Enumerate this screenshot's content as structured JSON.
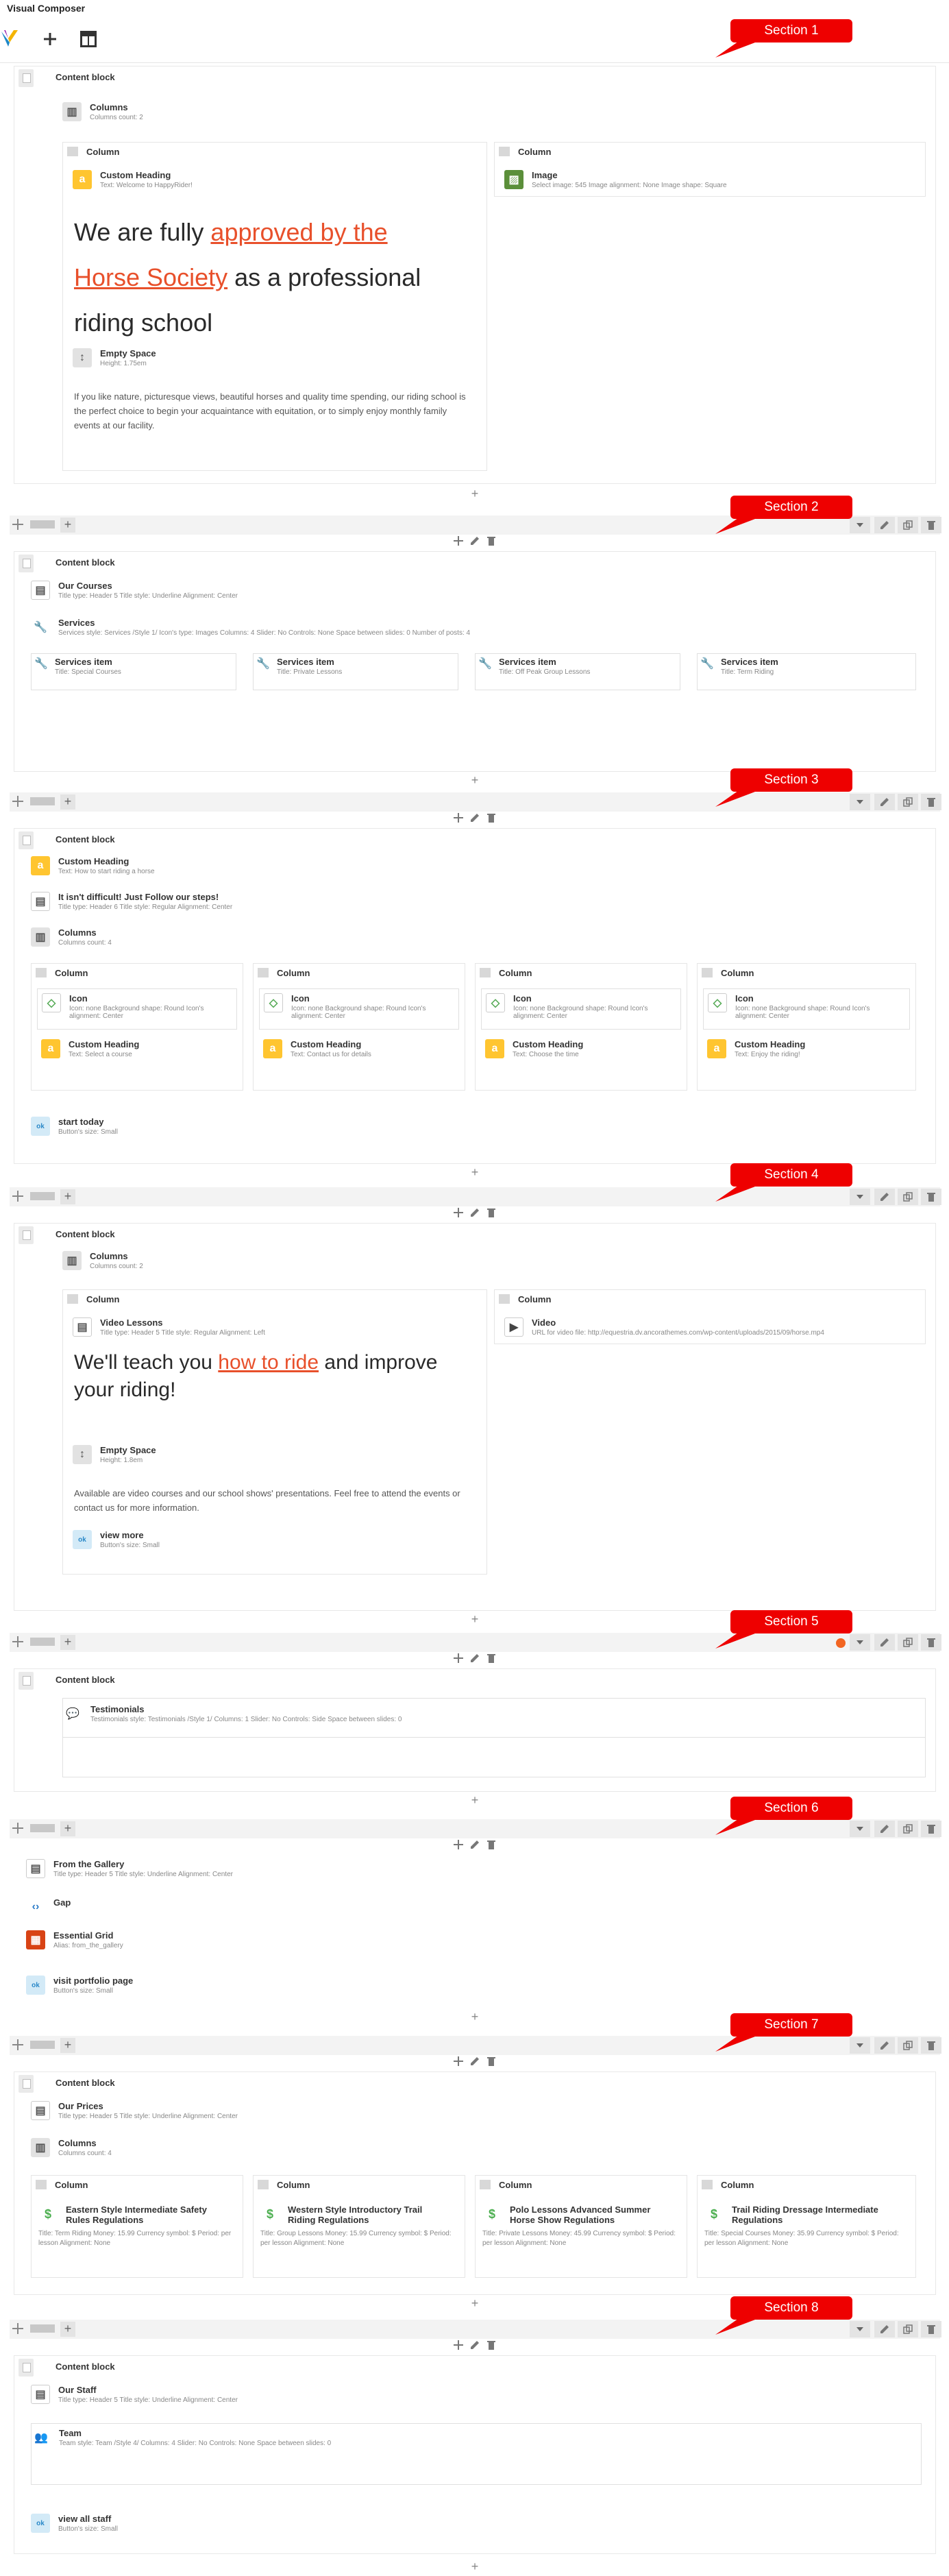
{
  "app_title": "Visual Composer",
  "toolbar": {
    "add_label": "+",
    "templates_icon": "layout-icon"
  },
  "sections": [
    {
      "label": "Section 1"
    },
    {
      "label": "Section 2"
    },
    {
      "label": "Section 3"
    },
    {
      "label": "Section 4"
    },
    {
      "label": "Section 5"
    },
    {
      "label": "Section 6"
    },
    {
      "label": "Section 7"
    },
    {
      "label": "Section 8"
    }
  ],
  "common": {
    "content_block": "Content block",
    "column": "Column",
    "add": "+"
  },
  "s1": {
    "columns_title": "Columns",
    "columns_params": "Columns count: 2",
    "heading_title": "Custom Heading",
    "heading_params": "Text: Welcome to HappyRider!",
    "big_pre": "We are fully",
    "big_link": "approved by the Horse Society",
    "big_post": "as a professional riding school",
    "space_title": "Empty Space",
    "space_params": "Height: 1.75em",
    "paragraph": "If you like nature, picturesque views, beautiful horses and quality time spending, our riding school is the perfect choice to begin your acquaintance with equitation, or to simply enjoy monthly family events at our facility.",
    "image_title": "Image",
    "image_params": "Select image: 545 Image alignment: None Image shape: Square"
  },
  "s2": {
    "heading_title": "Our Courses",
    "heading_params": "Title type: Header 5 Title style: Underline Alignment: Center",
    "services_title": "Services",
    "services_params": "Services style: Services /Style 1/ Icon's type: Images Columns: 4 Slider: No Controls: None Space between slides: 0 Number of posts: 4",
    "items": [
      {
        "title": "Services item",
        "params": "Title: Special Courses"
      },
      {
        "title": "Services item",
        "params": "Title: Private Lessons"
      },
      {
        "title": "Services item",
        "params": "Title: Off Peak Group Lessons"
      },
      {
        "title": "Services item",
        "params": "Title: Term Riding"
      }
    ]
  },
  "s3": {
    "h1_title": "Custom Heading",
    "h1_params": "Text: How to start riding a horse",
    "h2_title": "It isn't difficult! Just Follow our steps!",
    "h2_params": "Title type: Header 6 Title style: Regular Alignment: Center",
    "columns_title": "Columns",
    "columns_params": "Columns count: 4",
    "cols": [
      {
        "icon_title": "Icon",
        "icon_params": "Icon: none Background shape: Round Icon's alignment: Center",
        "heading_title": "Custom Heading",
        "heading_params": "Text: Select a course"
      },
      {
        "icon_title": "Icon",
        "icon_params": "Icon: none Background shape: Round Icon's alignment: Center",
        "heading_title": "Custom Heading",
        "heading_params": "Text: Contact us for details"
      },
      {
        "icon_title": "Icon",
        "icon_params": "Icon: none Background shape: Round Icon's alignment: Center",
        "heading_title": "Custom Heading",
        "heading_params": "Text: Choose the time"
      },
      {
        "icon_title": "Icon",
        "icon_params": "Icon: none Background shape: Round Icon's alignment: Center",
        "heading_title": "Custom Heading",
        "heading_params": "Text: Enjoy the riding!"
      }
    ],
    "button_title": "start today",
    "button_params": "Button's size: Small"
  },
  "s4": {
    "columns_title": "Columns",
    "columns_params": "Columns count: 2",
    "heading_title": "Video Lessons",
    "heading_params": "Title type: Header 5 Title style: Regular Alignment: Left",
    "big_pre": "We'll teach you",
    "big_link": "how to ride",
    "big_post": "and improve your riding!",
    "space_title": "Empty Space",
    "space_params": "Height: 1.8em",
    "paragraph": "Available are video courses and our school shows' presentations. Feel free to attend the events or contact us for more information.",
    "button_title": "view more",
    "button_params": "Button's size: Small",
    "video_title": "Video",
    "video_params": "URL for video file: http://equestria.dv.ancorathemes.com/wp-content/uploads/2015/09/horse.mp4"
  },
  "s5": {
    "title": "Testimonials",
    "params": "Testimonials style: Testimonials /Style 1/ Columns: 1 Slider: No Controls: Side Space between slides: 0"
  },
  "s6": {
    "heading_title": "From the Gallery",
    "heading_params": "Title type: Header 5 Title style: Underline Alignment: Center",
    "gap_title": "Gap",
    "grid_title": "Essential Grid",
    "grid_params": "Alias: from_the_gallery",
    "button_title": "visit portfolio page",
    "button_params": "Button's size: Small"
  },
  "s7": {
    "heading_title": "Our Prices",
    "heading_params": "Title type: Header 5 Title style: Underline Alignment: Center",
    "columns_title": "Columns",
    "columns_params": "Columns count: 4",
    "prices": [
      {
        "title": "Eastern Style Intermediate Safety Rules Regulations",
        "params": "Title: Term Riding Money: 15.99 Currency symbol: $ Period: per lesson Alignment: None"
      },
      {
        "title": "Western Style Introductory Trail Riding Regulations",
        "params": "Title: Group Lessons Money: 15.99 Currency symbol: $ Period: per lesson Alignment: None"
      },
      {
        "title": "Polo Lessons Advanced Summer Horse Show Regulations",
        "params": "Title: Private Lessons Money: 45.99 Currency symbol: $ Period: per lesson Alignment: None"
      },
      {
        "title": "Trail Riding Dressage Intermediate Regulations",
        "params": "Title: Special Courses Money: 35.99 Currency symbol: $ Period: per lesson Alignment: None"
      }
    ]
  },
  "s8": {
    "heading_title": "Our Staff",
    "heading_params": "Title type: Header 5 Title style: Underline Alignment: Center",
    "team_title": "Team",
    "team_params": "Team style: Team /Style 4/ Columns: 4 Slider: No Controls: None Space between slides: 0",
    "button_title": "view all staff",
    "button_params": "Button's size: Small"
  }
}
